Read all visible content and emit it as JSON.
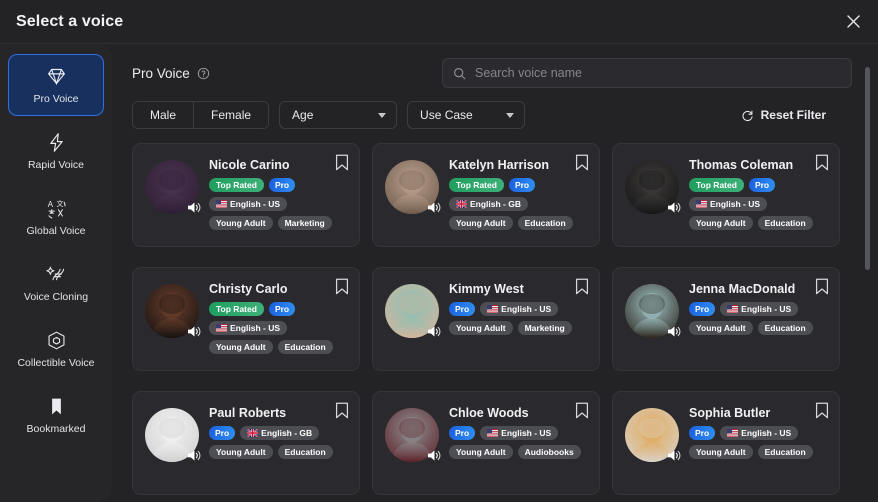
{
  "header": {
    "title": "Select a voice",
    "close_icon": "close-icon"
  },
  "sidebar": {
    "items": [
      {
        "label": "Pro Voice",
        "icon": "diamond-icon",
        "active": true
      },
      {
        "label": "Rapid Voice",
        "icon": "lightning-icon",
        "active": false
      },
      {
        "label": "Global Voice",
        "icon": "translate-icon",
        "active": false
      },
      {
        "label": "Voice Cloning",
        "icon": "sparkle-dna-icon",
        "active": false
      },
      {
        "label": "Collectible Voice",
        "icon": "cube-icon",
        "active": false
      },
      {
        "label": "Bookmarked",
        "icon": "bookmark-filled-icon",
        "active": false
      }
    ]
  },
  "main": {
    "section_title": "Pro Voice",
    "help_icon": "question-circle-icon",
    "search": {
      "placeholder": "Search voice name",
      "value": "",
      "icon": "search-icon"
    },
    "filters": {
      "gender": [
        "Male",
        "Female"
      ],
      "age": {
        "label": "Age",
        "icon": "chevron-down-icon"
      },
      "use_case": {
        "label": "Use Case",
        "icon": "chevron-down-icon"
      },
      "reset": {
        "label": "Reset Filter",
        "icon": "refresh-icon"
      }
    },
    "scrollbar": {
      "thumb_top_pct": 3,
      "thumb_height_pct": 57
    }
  },
  "voices": [
    {
      "name": "Nicole Carino",
      "badges": [
        {
          "text": "Top Rated",
          "style": "top"
        },
        {
          "text": "Pro",
          "style": "pro"
        },
        {
          "text": "English - US",
          "style": "grey",
          "flag": "us"
        },
        {
          "text": "Young Adult",
          "style": "grey"
        },
        {
          "text": "Marketing",
          "style": "grey"
        }
      ],
      "avatar_colors": [
        "#4a3350",
        "#2b1d30"
      ],
      "bookmark_icon": "bookmark-outline-icon",
      "speaker_icon": "speaker-icon"
    },
    {
      "name": "Katelyn Harrison",
      "badges": [
        {
          "text": "Top Rated",
          "style": "top"
        },
        {
          "text": "Pro",
          "style": "pro"
        },
        {
          "text": "English - GB",
          "style": "grey",
          "flag": "gb"
        },
        {
          "text": "Young Adult",
          "style": "grey"
        },
        {
          "text": "Education",
          "style": "grey"
        }
      ],
      "avatar_colors": [
        "#b9a08c",
        "#6d584a"
      ],
      "bookmark_icon": "bookmark-outline-icon",
      "speaker_icon": "speaker-icon"
    },
    {
      "name": "Thomas Coleman",
      "badges": [
        {
          "text": "Top Rated",
          "style": "top"
        },
        {
          "text": "Pro",
          "style": "pro"
        },
        {
          "text": "English - US",
          "style": "grey",
          "flag": "us"
        },
        {
          "text": "Young Adult",
          "style": "grey"
        },
        {
          "text": "Education",
          "style": "grey"
        }
      ],
      "avatar_colors": [
        "#3d3b3a",
        "#141414"
      ],
      "bookmark_icon": "bookmark-outline-icon",
      "speaker_icon": "speaker-icon"
    },
    {
      "name": "Christy Carlo",
      "badges": [
        {
          "text": "Top Rated",
          "style": "top"
        },
        {
          "text": "Pro",
          "style": "pro"
        },
        {
          "text": "English - US",
          "style": "grey",
          "flag": "us"
        },
        {
          "text": "Young Adult",
          "style": "grey"
        },
        {
          "text": "Education",
          "style": "grey"
        }
      ],
      "avatar_colors": [
        "#6b3f2c",
        "#11100f"
      ],
      "bookmark_icon": "bookmark-outline-icon",
      "speaker_icon": "speaker-icon"
    },
    {
      "name": "Kimmy West",
      "badges": [
        {
          "text": "Pro",
          "style": "pro"
        },
        {
          "text": "English - US",
          "style": "grey",
          "flag": "us"
        },
        {
          "text": "Young Adult",
          "style": "grey"
        },
        {
          "text": "Marketing",
          "style": "grey"
        }
      ],
      "avatar_colors": [
        "#8fc0b4",
        "#d5b49c"
      ],
      "bookmark_icon": "bookmark-outline-icon",
      "speaker_icon": "speaker-icon"
    },
    {
      "name": "Jenna MacDonald",
      "badges": [
        {
          "text": "Pro",
          "style": "pro"
        },
        {
          "text": "English - US",
          "style": "grey",
          "flag": "us"
        },
        {
          "text": "Young Adult",
          "style": "grey"
        },
        {
          "text": "Education",
          "style": "grey"
        }
      ],
      "avatar_colors": [
        "#9fc3c4",
        "#2a2119"
      ],
      "bookmark_icon": "bookmark-outline-icon",
      "speaker_icon": "speaker-icon"
    },
    {
      "name": "Paul Roberts",
      "badges": [
        {
          "text": "Pro",
          "style": "pro"
        },
        {
          "text": "English - GB",
          "style": "grey",
          "flag": "gb"
        },
        {
          "text": "Young Adult",
          "style": "grey"
        },
        {
          "text": "Education",
          "style": "grey"
        }
      ],
      "avatar_colors": [
        "#f2f2f2",
        "#cfcfcf"
      ],
      "bookmark_icon": "bookmark-outline-icon",
      "speaker_icon": "speaker-icon"
    },
    {
      "name": "Chloe Woods",
      "badges": [
        {
          "text": "Pro",
          "style": "pro"
        },
        {
          "text": "English - US",
          "style": "grey",
          "flag": "us"
        },
        {
          "text": "Young Adult",
          "style": "grey"
        },
        {
          "text": "Audiobooks",
          "style": "grey"
        }
      ],
      "avatar_colors": [
        "#8e8e92",
        "#5c2026"
      ],
      "bookmark_icon": "bookmark-outline-icon",
      "speaker_icon": "speaker-icon"
    },
    {
      "name": "Sophia Butler",
      "badges": [
        {
          "text": "Pro",
          "style": "pro"
        },
        {
          "text": "English - US",
          "style": "grey",
          "flag": "us"
        },
        {
          "text": "Young Adult",
          "style": "grey"
        },
        {
          "text": "Education",
          "style": "grey"
        }
      ],
      "avatar_colors": [
        "#e0aa5e",
        "#d9d4cd"
      ],
      "bookmark_icon": "bookmark-outline-icon",
      "speaker_icon": "speaker-icon"
    }
  ],
  "colors": {
    "accent_blue": "#2f6fe4",
    "badge_green": "#1f9e5e",
    "badge_blue": "#1a5fe0",
    "panel": "#232326",
    "card": "#2a2a2e"
  }
}
